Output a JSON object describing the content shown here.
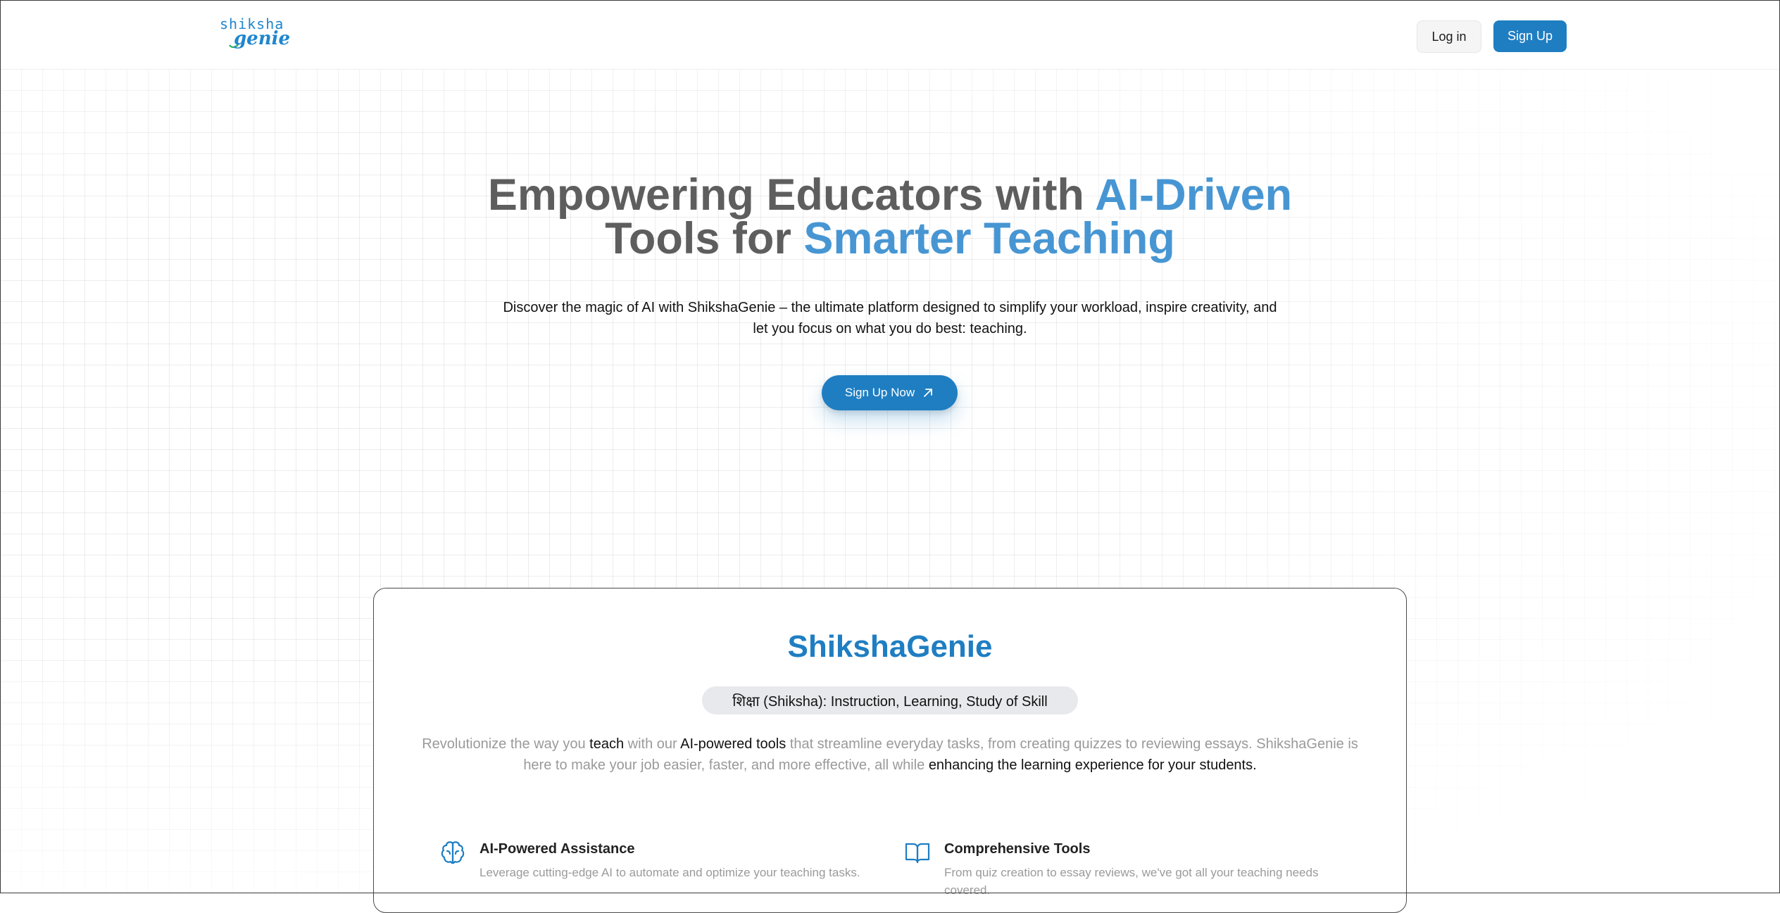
{
  "brand": {
    "logo_top": "shiksha",
    "logo_bottom": "genie",
    "accent_color": "#1f7ec2",
    "highlight_color": "#4796d3"
  },
  "nav": {
    "login_label": "Log in",
    "signup_label": "Sign Up"
  },
  "hero": {
    "title_part1": "Empowering Educators with ",
    "title_accent1": "AI-Driven",
    "title_part2": "Tools for ",
    "title_accent2": "Smarter Teaching",
    "description": "Discover the magic of AI with ShikshaGenie – the ultimate platform designed to simplify your workload, inspire creativity, and let you focus on what you do best: teaching.",
    "cta_label": "Sign Up Now",
    "cta_icon": "arrow-up-right-icon"
  },
  "about": {
    "title": "ShikshaGenie",
    "pill": "शिक्षा (Shiksha): Instruction, Learning, Study of Skill",
    "desc_1": "Revolutionize the way you ",
    "desc_teach": "teach",
    "desc_2": " with our ",
    "desc_tools": "AI-powered tools",
    "desc_3": " that streamline everyday tasks, from creating quizzes to reviewing essays. ShikshaGenie is here to make your job easier, faster, and more effective, all while ",
    "desc_enhance": "enhancing the learning experience for your students.",
    "features": [
      {
        "icon": "brain-icon",
        "title": "AI-Powered Assistance",
        "text": "Leverage cutting-edge AI to automate and optimize your teaching tasks."
      },
      {
        "icon": "book-open-icon",
        "title": "Comprehensive Tools",
        "text": "From quiz creation to essay reviews, we've got all your teaching needs covered."
      }
    ]
  }
}
